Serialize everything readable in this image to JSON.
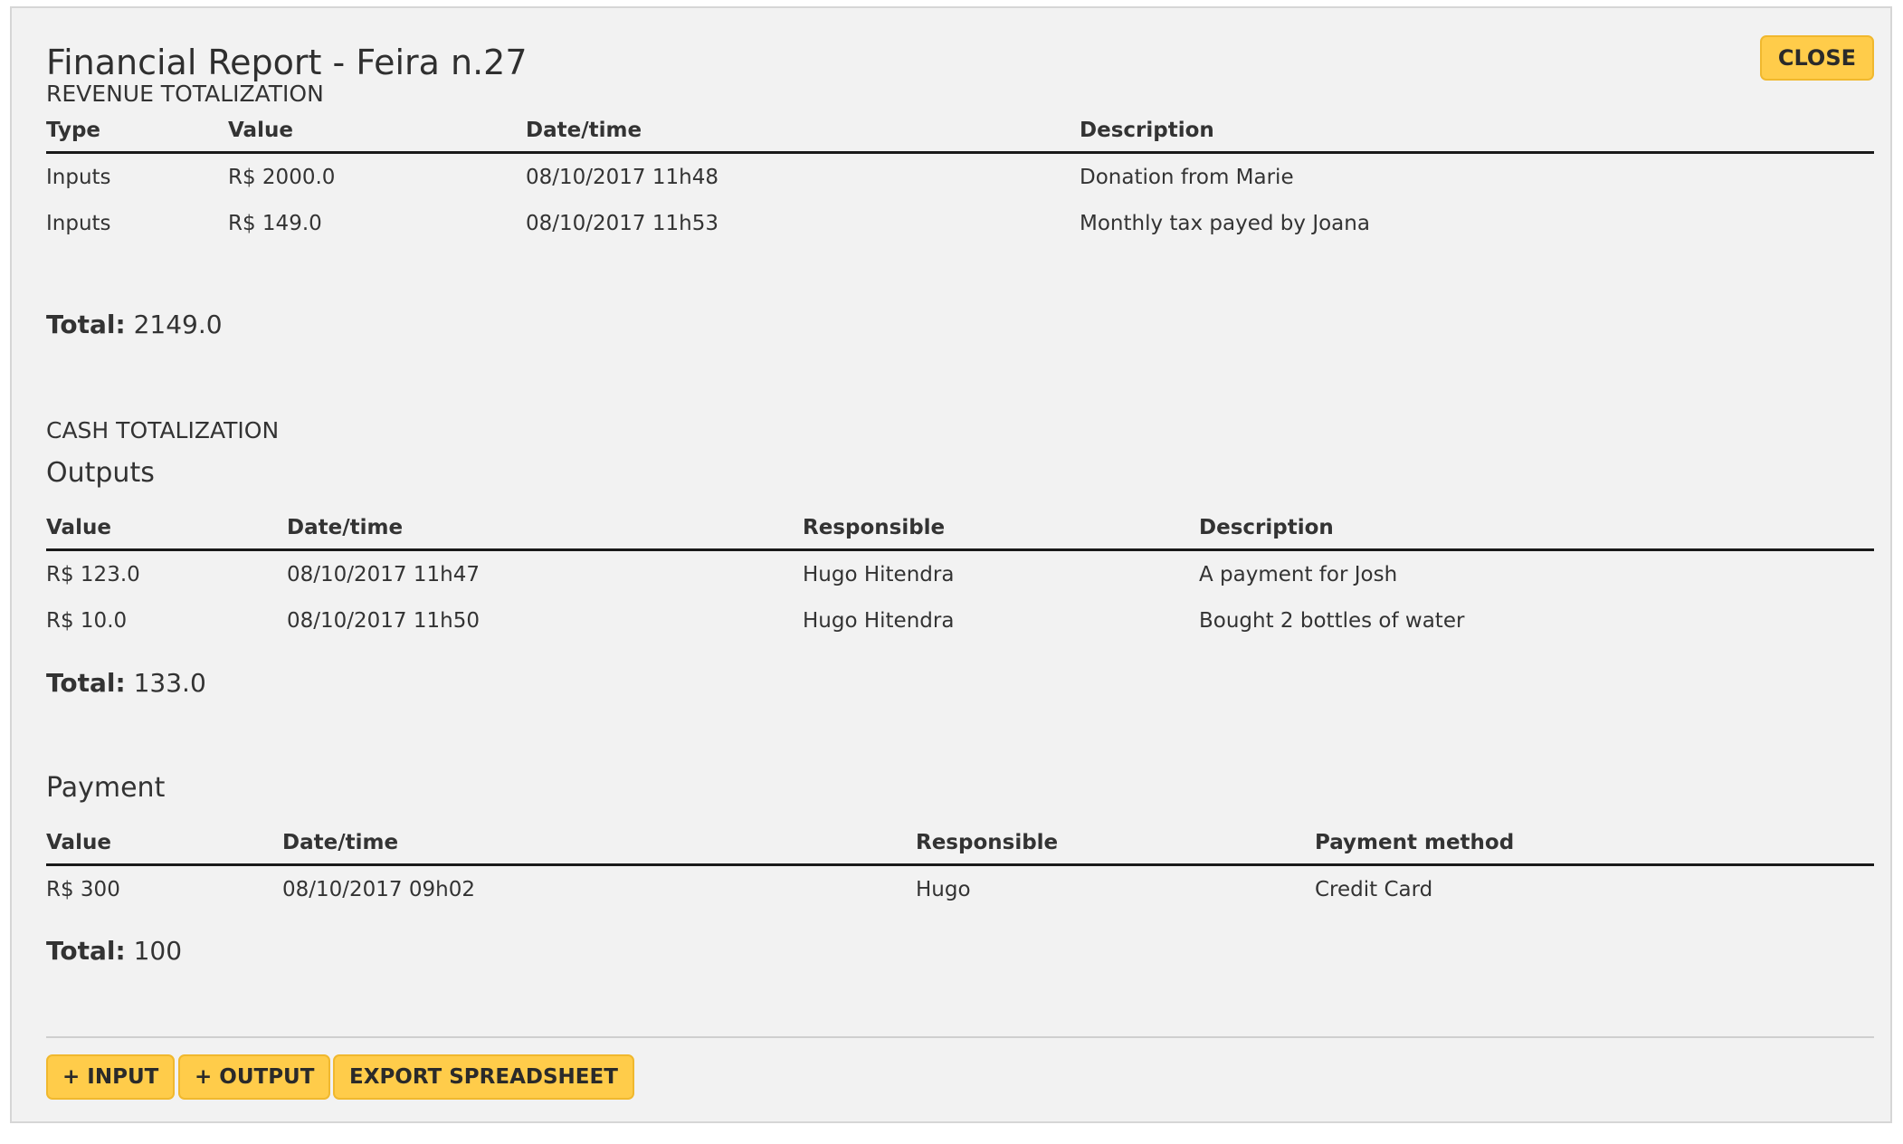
{
  "header": {
    "title": "Financial Report - Feira n.27",
    "close_label": "CLOSE"
  },
  "revenue": {
    "section_label": "REVENUE TOTALIZATION",
    "columns": [
      "Type",
      "Value",
      "Date/time",
      "Description"
    ],
    "rows": [
      [
        "Inputs",
        "R$ 2000.0",
        "08/10/2017 11h48",
        "Donation from Marie"
      ],
      [
        "Inputs",
        "R$ 149.0",
        "08/10/2017 11h53",
        "Monthly tax payed by Joana"
      ]
    ],
    "total_label": "Total:",
    "total_value": "2149.0"
  },
  "cash": {
    "section_label": "CASH TOTALIZATION",
    "outputs": {
      "title": "Outputs",
      "columns": [
        "Value",
        "Date/time",
        "Responsible",
        "Description"
      ],
      "rows": [
        [
          "R$ 123.0",
          "08/10/2017 11h47",
          "Hugo Hitendra",
          "A payment for Josh"
        ],
        [
          "R$ 10.0",
          "08/10/2017 11h50",
          "Hugo Hitendra",
          "Bought 2 bottles of water"
        ]
      ],
      "total_label": "Total:",
      "total_value": "133.0"
    },
    "payment": {
      "title": "Payment",
      "columns": [
        "Value",
        "Date/time",
        "Responsible",
        "Payment method"
      ],
      "rows": [
        [
          "R$ 300",
          "08/10/2017 09h02",
          "Hugo",
          "Credit Card"
        ]
      ],
      "total_label": "Total:",
      "total_value": "100"
    }
  },
  "footer": {
    "add_input_label": "+ INPUT",
    "add_output_label": "+ OUTPUT",
    "export_label": "EXPORT SPREADSHEET"
  },
  "colors": {
    "button_bg": "#ffcc4a",
    "button_border": "#f0b82e",
    "panel_bg": "#f2f2f2"
  }
}
